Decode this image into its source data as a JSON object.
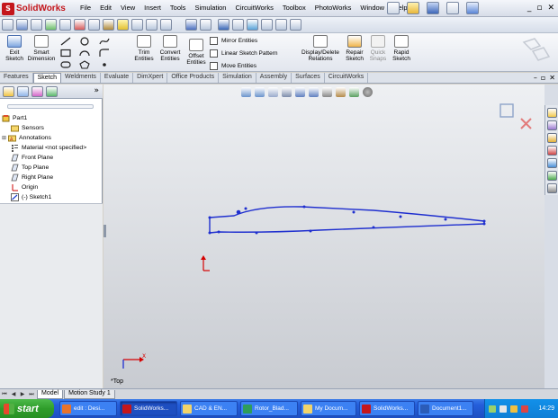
{
  "app": {
    "logo_text": "SolidWorks"
  },
  "menu": [
    "File",
    "Edit",
    "View",
    "Insert",
    "Tools",
    "Simulation",
    "CircuitWorks",
    "Toolbox",
    "PhotoWorks",
    "Window",
    "Help"
  ],
  "ribbon": {
    "exit_sketch": "Exit Sketch",
    "smart_dimension": "Smart Dimension",
    "trim_entities": "Trim Entities",
    "convert_entities": "Convert Entities",
    "offset_entities": "Offset Entities",
    "mirror_entities": "Mirror Entities",
    "linear_sketch_pattern": "Linear Sketch Pattern",
    "move_entities": "Move Entities",
    "display_delete_relations": "Display/Delete Relations",
    "repair_sketch": "Repair Sketch",
    "quick_snaps": "Quick Snaps",
    "rapid_sketch": "Rapid Sketch"
  },
  "tabs": [
    "Features",
    "Sketch",
    "Weldments",
    "Evaluate",
    "DimXpert",
    "Office Products",
    "Simulation",
    "Assembly",
    "Surfaces",
    "CircuitWorks"
  ],
  "active_tab": "Sketch",
  "feature_tree": {
    "root": "Part1",
    "items": [
      "Sensors",
      "Annotations",
      "Material <not specified>",
      "Front Plane",
      "Top Plane",
      "Right Plane",
      "Origin",
      "(-) Sketch1"
    ]
  },
  "view": {
    "orientation_label": "*Top"
  },
  "model_tabs": [
    "Model",
    "Motion Study 1"
  ],
  "taskbar": {
    "start": "start",
    "tasks": [
      "edit : Desi...",
      "SolidWorks...",
      "CAD & EN...",
      "Rotor_Blad...",
      "My Docum...",
      "SolidWorks...",
      "Document1..."
    ],
    "clock": "14:29"
  },
  "colors": {
    "sketch_line": "#1f2fcf",
    "origin_axis": "#d40000"
  }
}
